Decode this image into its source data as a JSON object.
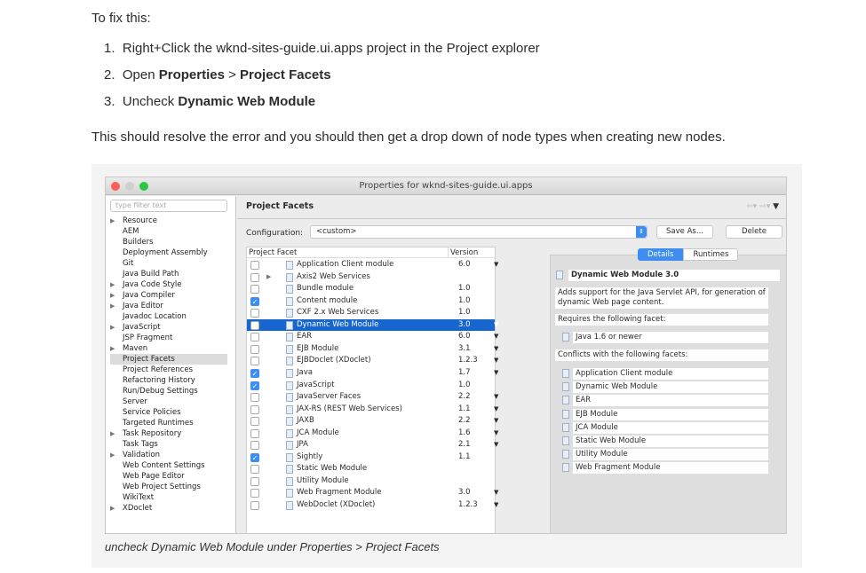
{
  "intro": "To fix this:",
  "steps": [
    {
      "num": "1.",
      "pre": "Right+Click the wknd-sites-guide.ui.apps project in the Project explorer"
    },
    {
      "num": "2.",
      "pre": "Open ",
      "b1": "Properties",
      "mid": " > ",
      "b2": "Project Facets"
    },
    {
      "num": "3.",
      "pre": "Uncheck ",
      "b1": "Dynamic Web Module"
    }
  ],
  "outro": "This should resolve the error and you should then get a drop down of node types when creating new nodes.",
  "caption": "uncheck Dynamic Web Module under Properties > Project Facets",
  "dialog": {
    "title": "Properties for wknd-sites-guide.ui.apps",
    "filter_placeholder": "type filter text",
    "tree": [
      {
        "label": "Resource",
        "exp": true
      },
      {
        "label": "AEM"
      },
      {
        "label": "Builders"
      },
      {
        "label": "Deployment Assembly"
      },
      {
        "label": "Git"
      },
      {
        "label": "Java Build Path"
      },
      {
        "label": "Java Code Style",
        "exp": true
      },
      {
        "label": "Java Compiler",
        "exp": true
      },
      {
        "label": "Java Editor",
        "exp": true
      },
      {
        "label": "Javadoc Location"
      },
      {
        "label": "JavaScript",
        "exp": true
      },
      {
        "label": "JSP Fragment"
      },
      {
        "label": "Maven",
        "exp": true
      },
      {
        "label": "Project Facets",
        "selected": true
      },
      {
        "label": "Project References"
      },
      {
        "label": "Refactoring History"
      },
      {
        "label": "Run/Debug Settings"
      },
      {
        "label": "Server"
      },
      {
        "label": "Service Policies"
      },
      {
        "label": "Targeted Runtimes"
      },
      {
        "label": "Task Repository",
        "exp": true
      },
      {
        "label": "Task Tags"
      },
      {
        "label": "Validation",
        "exp": true
      },
      {
        "label": "Web Content Settings"
      },
      {
        "label": "Web Page Editor"
      },
      {
        "label": "Web Project Settings"
      },
      {
        "label": "WikiText"
      },
      {
        "label": "XDoclet",
        "exp": true
      }
    ],
    "header": "Project Facets",
    "config_label": "Configuration:",
    "config_value": "<custom>",
    "save_as": "Save As...",
    "delete": "Delete",
    "col_facet": "Project Facet",
    "col_version": "Version",
    "facets": [
      {
        "name": "Application Client module",
        "version": "6.0",
        "dd": true,
        "checked": false
      },
      {
        "name": "Axis2 Web Services",
        "version": "",
        "checked": false,
        "exp": true
      },
      {
        "name": "Bundle module",
        "version": "1.0",
        "checked": false
      },
      {
        "name": "Content module",
        "version": "1.0",
        "checked": true
      },
      {
        "name": "CXF 2.x Web Services",
        "version": "1.0",
        "checked": false
      },
      {
        "name": "Dynamic Web Module",
        "version": "3.0",
        "dd": true,
        "checked": false,
        "selected": true
      },
      {
        "name": "EAR",
        "version": "6.0",
        "dd": true,
        "checked": false
      },
      {
        "name": "EJB Module",
        "version": "3.1",
        "dd": true,
        "checked": false
      },
      {
        "name": "EJBDoclet (XDoclet)",
        "version": "1.2.3",
        "dd": true,
        "checked": false
      },
      {
        "name": "Java",
        "version": "1.7",
        "dd": true,
        "checked": true
      },
      {
        "name": "JavaScript",
        "version": "1.0",
        "checked": true
      },
      {
        "name": "JavaServer Faces",
        "version": "2.2",
        "dd": true,
        "checked": false
      },
      {
        "name": "JAX-RS (REST Web Services)",
        "version": "1.1",
        "dd": true,
        "checked": false
      },
      {
        "name": "JAXB",
        "version": "2.2",
        "dd": true,
        "checked": false
      },
      {
        "name": "JCA Module",
        "version": "1.6",
        "dd": true,
        "checked": false
      },
      {
        "name": "JPA",
        "version": "2.1",
        "dd": true,
        "checked": false
      },
      {
        "name": "Sightly",
        "version": "1.1",
        "checked": true
      },
      {
        "name": "Static Web Module",
        "version": "",
        "checked": false
      },
      {
        "name": "Utility Module",
        "version": "",
        "checked": false
      },
      {
        "name": "Web Fragment Module",
        "version": "3.0",
        "dd": true,
        "checked": false
      },
      {
        "name": "WebDoclet (XDoclet)",
        "version": "1.2.3",
        "dd": true,
        "checked": false
      }
    ],
    "tab_details": "Details",
    "tab_runtimes": "Runtimes",
    "detail_title": "Dynamic Web Module 3.0",
    "detail_desc": "Adds support for the Java Servlet API, for generation of dynamic Web page content.",
    "requires_label": "Requires the following facet:",
    "requires": [
      "Java 1.6 or newer"
    ],
    "conflicts_label": "Conflicts with the following facets:",
    "conflicts": [
      "Application Client module",
      "Dynamic Web Module",
      "EAR",
      "EJB Module",
      "JCA Module",
      "Static Web Module",
      "Utility Module",
      "Web Fragment Module"
    ],
    "colors": {
      "selection": "#1766d0",
      "accent": "#3d8ef0"
    }
  }
}
